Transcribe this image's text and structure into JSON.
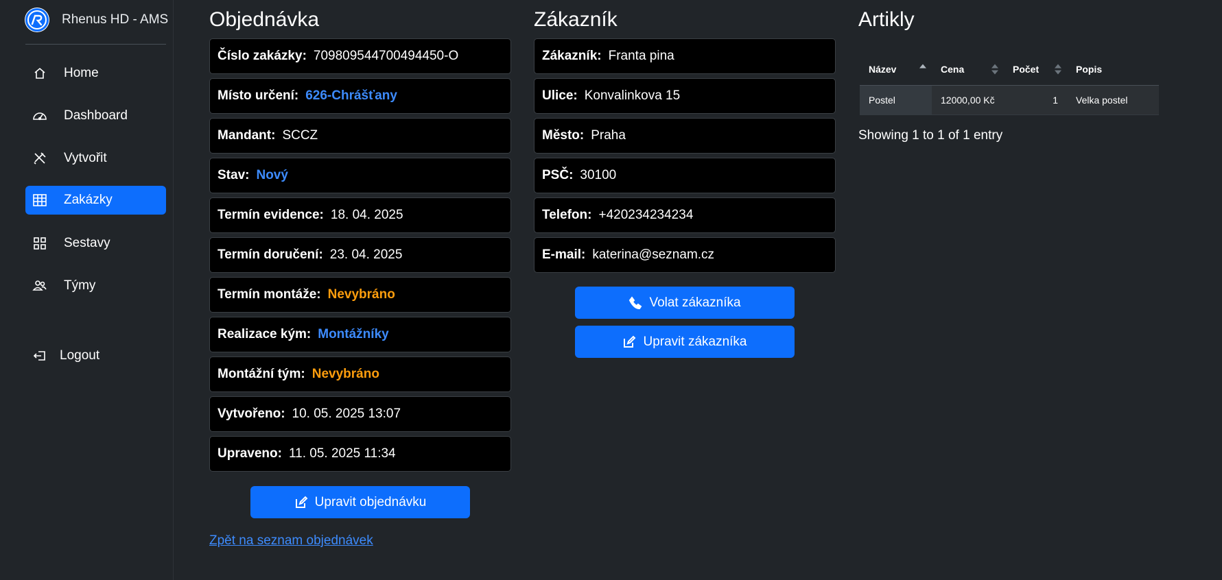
{
  "app": {
    "title": "Rhenus HD - AMS"
  },
  "sidebar": {
    "items": [
      {
        "label": "Home",
        "icon": "home-icon"
      },
      {
        "label": "Dashboard",
        "icon": "speedometer-icon"
      },
      {
        "label": "Vytvořit",
        "icon": "tools-icon"
      },
      {
        "label": "Zakázky",
        "icon": "table-icon",
        "active": true
      },
      {
        "label": "Sestavy",
        "icon": "grid-icon"
      },
      {
        "label": "Týmy",
        "icon": "people-icon"
      }
    ],
    "logout": {
      "label": "Logout",
      "icon": "box-arrow-left-icon"
    }
  },
  "order": {
    "title": "Objednávka",
    "fields": [
      {
        "label": "Číslo zakázky:",
        "value": "709809544700494450-O",
        "style": "plain"
      },
      {
        "label": "Místo určení:",
        "value": "626-Chrášťany",
        "style": "blue"
      },
      {
        "label": "Mandant:",
        "value": "SCCZ",
        "style": "plain"
      },
      {
        "label": "Stav:",
        "value": "Nový",
        "style": "blue"
      },
      {
        "label": "Termín evidence:",
        "value": "18. 04. 2025",
        "style": "plain"
      },
      {
        "label": "Termín doručení:",
        "value": "23. 04. 2025",
        "style": "plain"
      },
      {
        "label": "Termín montáže:",
        "value": "Nevybráno",
        "style": "orange"
      },
      {
        "label": "Realizace kým:",
        "value": "Montážníky",
        "style": "blue"
      },
      {
        "label": "Montážní tým:",
        "value": "Nevybráno",
        "style": "orange"
      },
      {
        "label": "Vytvořeno:",
        "value": "10. 05. 2025 13:07",
        "style": "plain"
      },
      {
        "label": "Upraveno:",
        "value": "11. 05. 2025 11:34",
        "style": "plain"
      }
    ],
    "edit_button": "Upravit objednávku",
    "back_link": "Zpět na seznam objednávek"
  },
  "customer": {
    "title": "Zákazník",
    "fields": [
      {
        "label": "Zákazník:",
        "value": "Franta pina"
      },
      {
        "label": "Ulice:",
        "value": "Konvalinkova 15"
      },
      {
        "label": "Město:",
        "value": "Praha"
      },
      {
        "label": "PSČ:",
        "value": "30100"
      },
      {
        "label": "Telefon:",
        "value": "+420234234234"
      },
      {
        "label": "E-mail:",
        "value": "katerina@seznam.cz"
      }
    ],
    "call_button": "Volat zákazníka",
    "edit_button": "Upravit zákazníka"
  },
  "articles": {
    "title": "Artikly",
    "columns": [
      "Název",
      "Cena",
      "Počet",
      "Popis"
    ],
    "rows": [
      [
        "Postel",
        "12000,00 Kč",
        "1",
        "Velka postel"
      ]
    ],
    "info": "Showing 1 to 1 of 1 entry"
  },
  "colors": {
    "accent": "#0d6efd",
    "link_blue": "#3d8bfd",
    "warning_orange": "#fd9d0d",
    "background": "#212529"
  }
}
